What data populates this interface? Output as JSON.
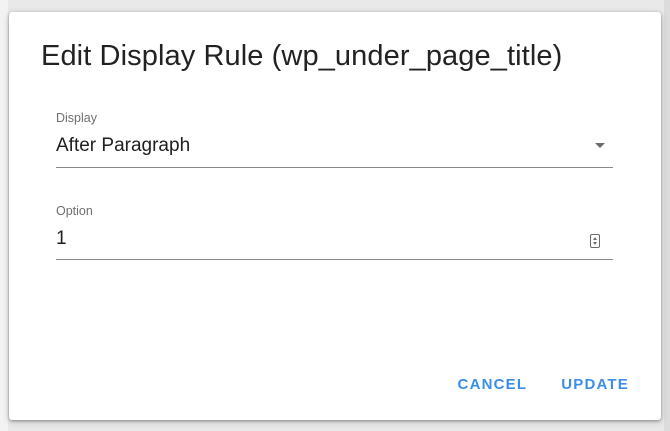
{
  "dialog": {
    "title": "Edit Display Rule (wp_under_page_title)",
    "display_field": {
      "label": "Display",
      "value": "After Paragraph"
    },
    "option_field": {
      "label": "Option",
      "value": "1"
    },
    "actions": {
      "cancel_label": "CANCEL",
      "update_label": "UPDATE"
    }
  },
  "colors": {
    "accent": "#3a8ee6",
    "text": "#202020",
    "label": "#6f6f6f",
    "divider": "#8a8a8a"
  },
  "icons": {
    "display_dropdown": "chevron-down-icon",
    "option_stepper": "number-stepper-icon"
  }
}
